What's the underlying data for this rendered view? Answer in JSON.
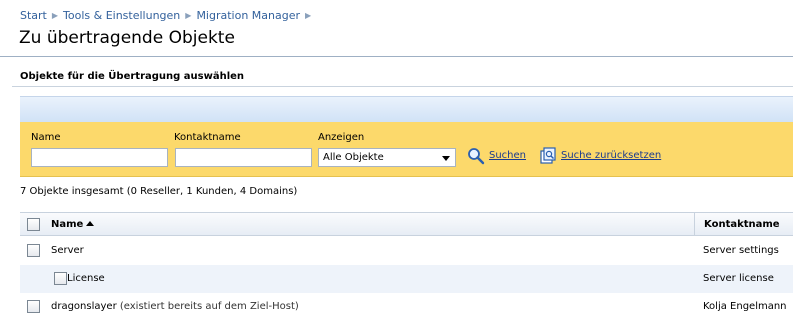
{
  "breadcrumb": [
    "Start",
    "Tools & Einstellungen",
    "Migration Manager"
  ],
  "page_title": "Zu übertragende Objekte",
  "section_title": "Objekte für die Übertragung auswählen",
  "filters": {
    "name_label": "Name",
    "name_value": "",
    "contact_label": "Kontaktname",
    "contact_value": "",
    "show_label": "Anzeigen",
    "show_selected": "Alle Objekte",
    "search_label": "Suchen",
    "reset_label": "Suche zurücksetzen"
  },
  "summary": "7 Objekte insgesamt (0 Reseller, 1 Kunden, 4 Domains)",
  "table": {
    "columns": [
      "Name",
      "Kontaktname"
    ],
    "rows": [
      {
        "name": "Server",
        "note": "",
        "contact": "Server settings",
        "indent": false
      },
      {
        "name": "License",
        "note": "",
        "contact": "Server license",
        "indent": true
      },
      {
        "name": "dragonslayer",
        "note": "(existiert bereits auf dem Ziel-Host)",
        "contact": "Kolja Engelmann",
        "indent": false
      }
    ]
  },
  "colors": {
    "link": "#33619c",
    "filter_panel": "#fcd96b",
    "row_alt": "#eef3fa"
  },
  "icons": {
    "search": "magnifier-icon",
    "reset": "reset-search-icon",
    "sort": "sort-ascending-icon"
  }
}
